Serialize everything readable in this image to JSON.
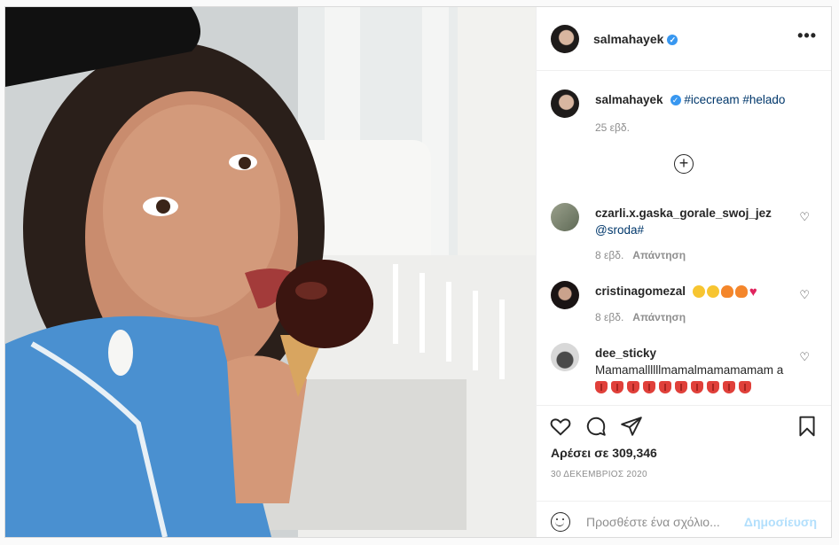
{
  "post": {
    "username": "salmahayek",
    "verified_icon": "verified-badge-icon",
    "more_icon": "more-options-icon"
  },
  "caption": {
    "username": "salmahayek",
    "tags": [
      "#icecream",
      "#helado"
    ],
    "time": "25 εβδ."
  },
  "load_more_icon": "plus-circle-icon",
  "comments": [
    {
      "username": "czarli.x.gaska_gorale_swoj_jez",
      "text": "@sroda#",
      "time": "8 εβδ.",
      "reply": "Απάντηση"
    },
    {
      "username": "cristinagomezal",
      "text": "",
      "emojis": [
        "laughing-face",
        "laughing-face",
        "fire",
        "fire",
        "red-heart"
      ],
      "time": "8 εβδ.",
      "reply": "Απάντηση"
    },
    {
      "username": "dee_sticky",
      "text": "Mamamallllllmamalmamamamam a",
      "emojis": [
        "tongue",
        "tongue",
        "tongue",
        "tongue",
        "tongue",
        "tongue",
        "tongue",
        "tongue",
        "tongue",
        "tongue"
      ]
    }
  ],
  "actions": {
    "like_icon": "heart-icon",
    "comment_icon": "comment-icon",
    "share_icon": "send-icon",
    "save_icon": "bookmark-icon",
    "likes": "Αρέσει σε 309,346",
    "date": "30 ΔΕΚΕΜΒΡΙΟΣ 2020"
  },
  "add_comment": {
    "placeholder": "Προσθέστε ένα σχόλιο...",
    "post_label": "Δημοσίευση"
  },
  "colors": {
    "verified": "#3897f0",
    "hashtag": "#00376b",
    "muted": "#8e8e8e",
    "post_disabled": "#b2dffc"
  }
}
